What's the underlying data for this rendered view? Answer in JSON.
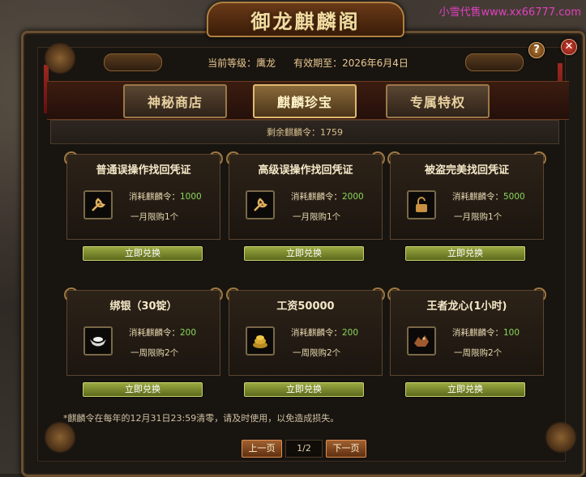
{
  "watermark": "小雪代售www.xx66777.com",
  "window": {
    "title": "御龙麒麟阁"
  },
  "info": {
    "level_text": "当前等级：鹰龙",
    "expiry_text": "有效期至：2026年6月4日"
  },
  "tabs": [
    {
      "label": "神秘商店",
      "active": false
    },
    {
      "label": "麒麟珍宝",
      "active": true
    },
    {
      "label": "专属特权",
      "active": false
    }
  ],
  "remaining_text": "剩余麒麟令：1759",
  "items": [
    {
      "title": "普通误操作找回凭证",
      "icon": "wrench-icon",
      "cost_label": "消耗麒麟令：",
      "cost": "1000",
      "limit": "一月限购1个",
      "button": "立即兑换"
    },
    {
      "title": "高级误操作找回凭证",
      "icon": "wrench-icon",
      "cost_label": "消耗麒麟令：",
      "cost": "2000",
      "limit": "一月限购1个",
      "button": "立即兑换"
    },
    {
      "title": "被盗完美找回凭证",
      "icon": "lock-icon",
      "cost_label": "消耗麒麟令：",
      "cost": "5000",
      "limit": "一月限购1个",
      "button": "立即兑换"
    },
    {
      "title": "绑银（30锭）",
      "icon": "silver-ingot-icon",
      "cost_label": "消耗麒麟令：",
      "cost": "200",
      "limit": "一周限购2个",
      "button": "立即兑换"
    },
    {
      "title": "工资50000",
      "icon": "gold-coins-icon",
      "cost_label": "消耗麒麟令：",
      "cost": "200",
      "limit": "一周限购2个",
      "button": "立即兑换"
    },
    {
      "title": "王者龙心(1小时)",
      "icon": "dragon-heart-icon",
      "cost_label": "消耗麒麟令：",
      "cost": "100",
      "limit": "一周限购2个",
      "button": "立即兑换"
    }
  ],
  "note": "*麒麟令在每年的12月31日23:59清零，请及时使用，以免造成损失。",
  "pager": {
    "prev": "上一页",
    "page": "1/2",
    "next": "下一页"
  },
  "controls": {
    "help": "?",
    "close": "✕"
  }
}
